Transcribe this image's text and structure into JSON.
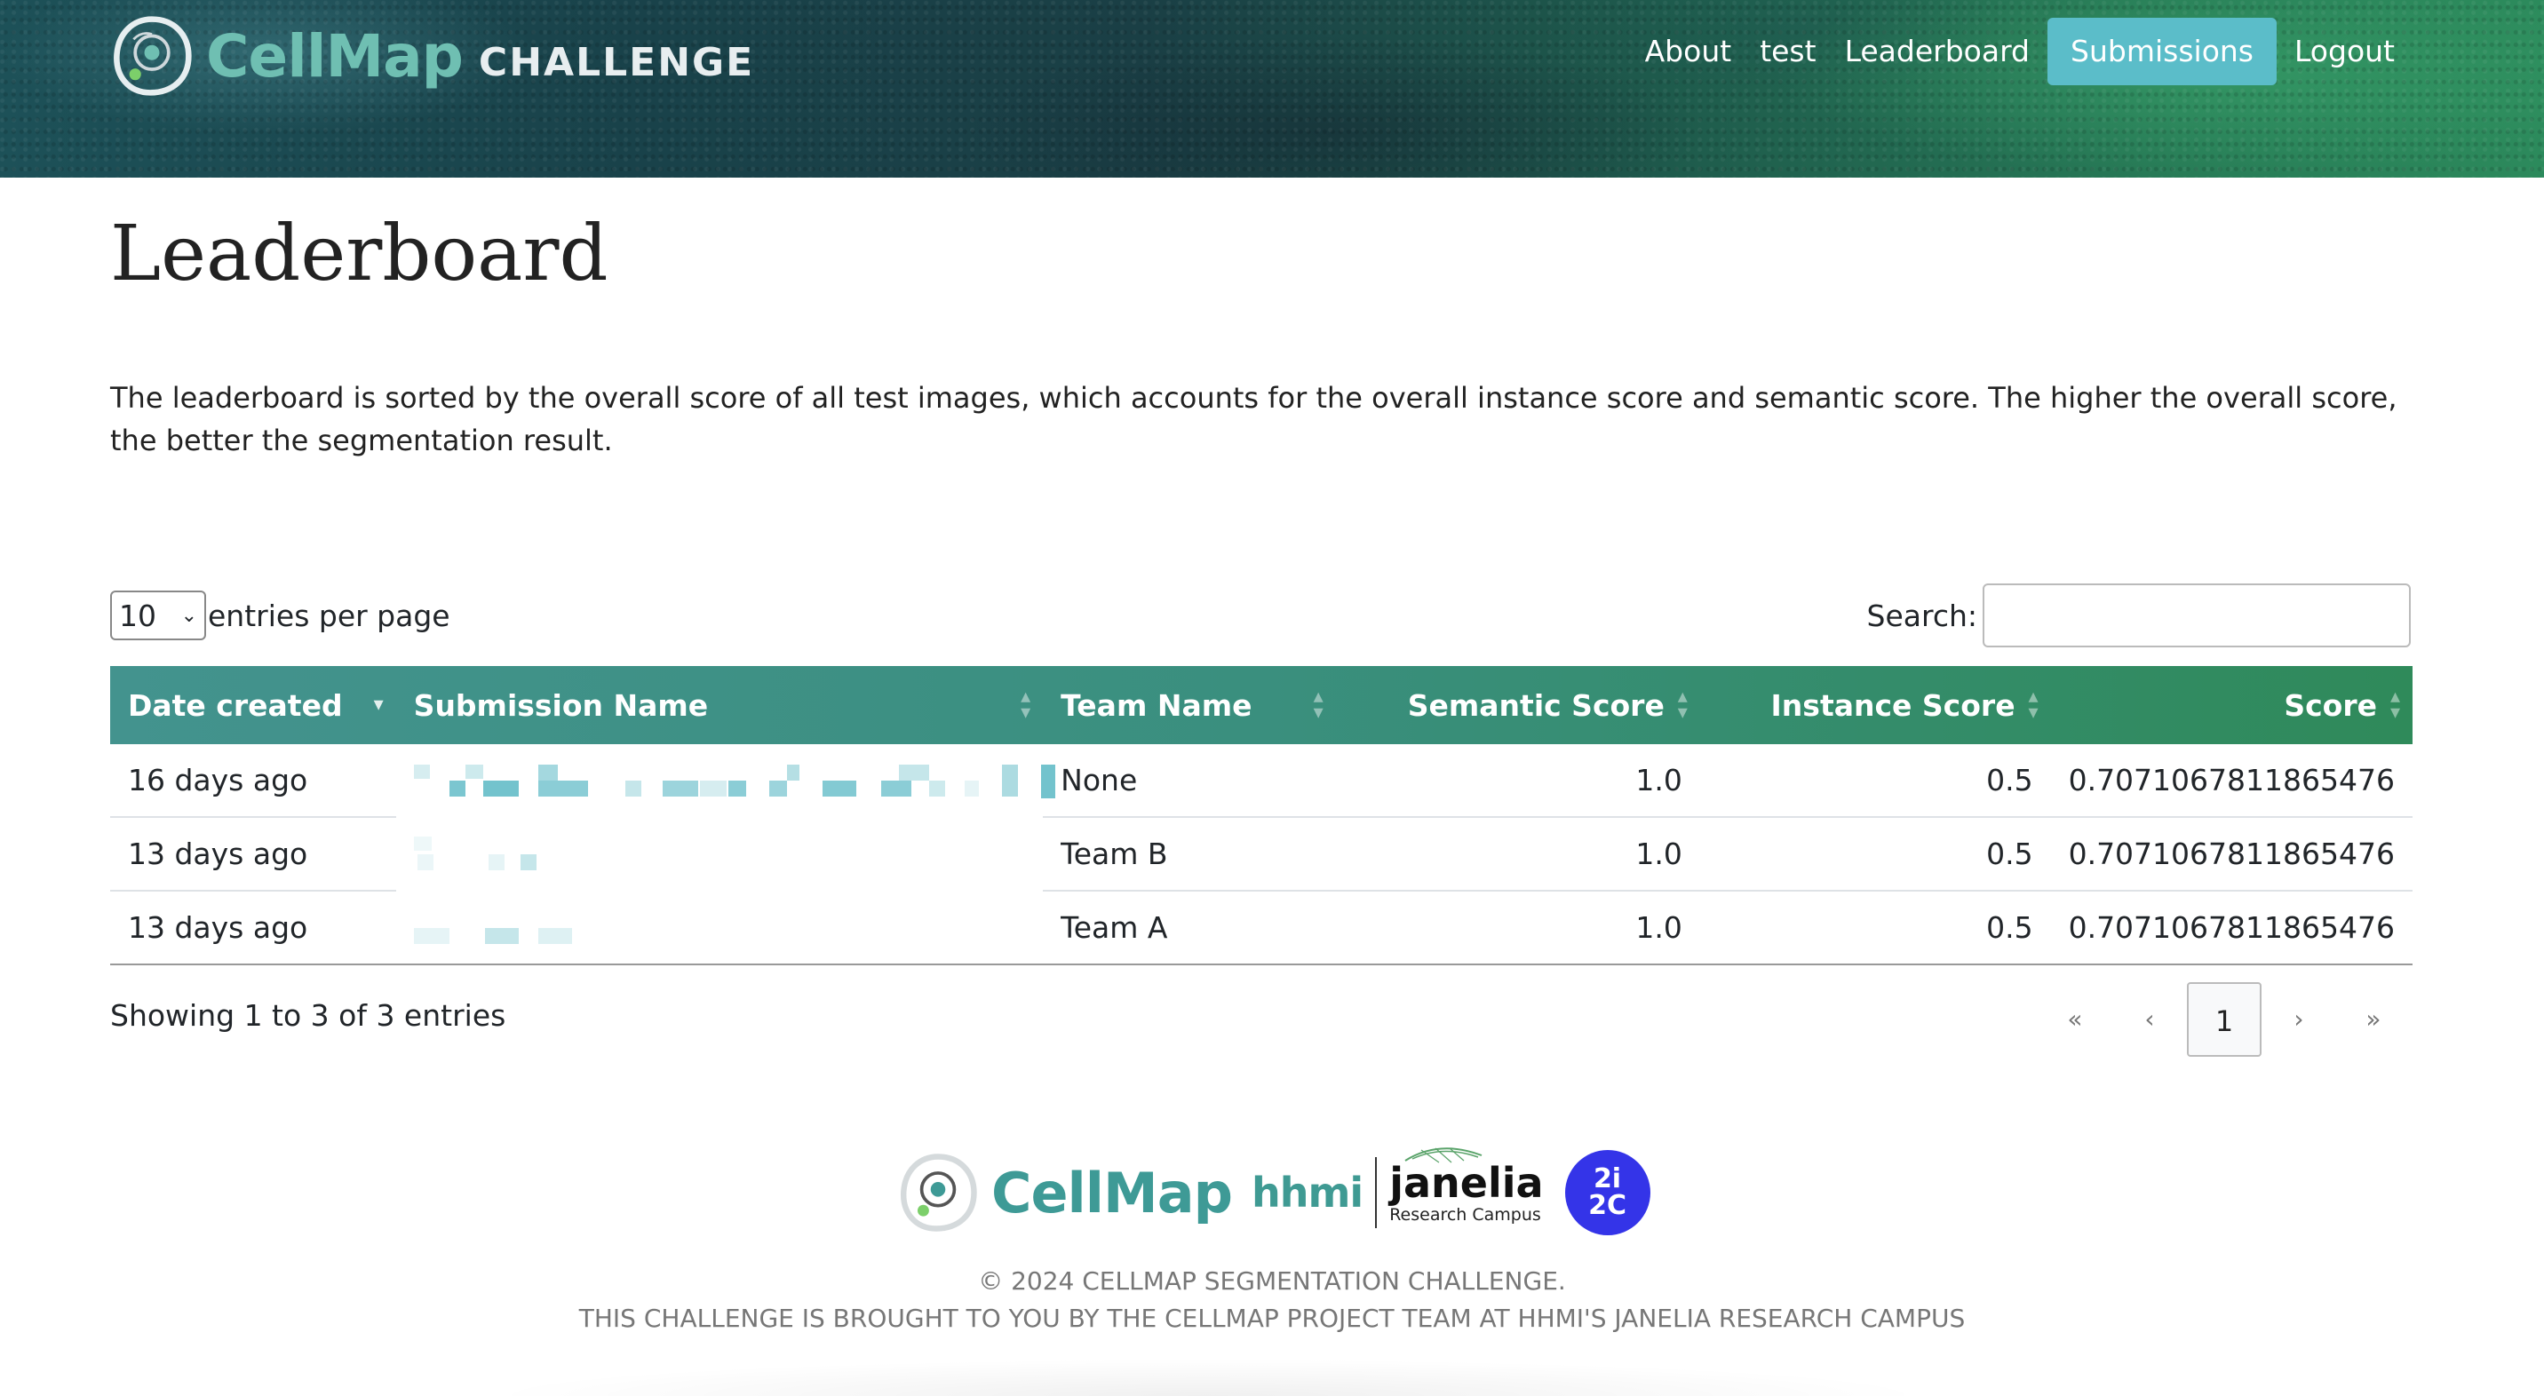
{
  "brand": {
    "name": "CellMap",
    "suffix": "CHALLENGE"
  },
  "nav": {
    "items": [
      {
        "label": "About"
      },
      {
        "label": "test"
      },
      {
        "label": "Leaderboard"
      },
      {
        "label": "Submissions",
        "active": true
      },
      {
        "label": "Logout"
      }
    ]
  },
  "page": {
    "title": "Leaderboard",
    "description": "The leaderboard is sorted by the overall score of all test images, which accounts for the overall instance score and semantic score. The higher the overall score, the better the segmentation result."
  },
  "controls": {
    "page_length": "10",
    "page_length_label": "entries per page",
    "search_label": "Search:",
    "search_value": ""
  },
  "table": {
    "columns": [
      "Date created",
      "Submission Name",
      "Team Name",
      "Semantic Score",
      "Instance Score",
      "Score"
    ],
    "rows": [
      {
        "date": "16 days ago",
        "submission": "",
        "team": "None",
        "semantic": "1.0",
        "instance": "0.5",
        "score": "0.7071067811865476"
      },
      {
        "date": "13 days ago",
        "submission": "",
        "team": "Team B",
        "semantic": "1.0",
        "instance": "0.5",
        "score": "0.7071067811865476"
      },
      {
        "date": "13 days ago",
        "submission": "",
        "team": "Team A",
        "semantic": "1.0",
        "instance": "0.5",
        "score": "0.7071067811865476"
      }
    ]
  },
  "pagination": {
    "info": "Showing 1 to 3 of 3 entries",
    "first": "«",
    "prev": "‹",
    "current": "1",
    "next": "›",
    "last": "»"
  },
  "footer": {
    "logo_cellmap": "CellMap",
    "logo_hhmi": "hhmi",
    "logo_janelia": "janelia",
    "logo_janelia_sub": "Research Campus",
    "logo_2i2c_top": "2i",
    "logo_2i2c_bottom": "2C",
    "copyright": "© 2024 CELLMAP SEGMENTATION CHALLENGE.",
    "credit": "THIS CHALLENGE IS BROUGHT TO YOU BY THE CELLMAP PROJECT TEAM AT HHMI'S JANELIA RESEARCH CAMPUS"
  },
  "colors": {
    "accent": "#5bbdc9",
    "table_header_start": "#43938e",
    "table_header_end": "#2f8a5a",
    "brand_teal": "#3e9a96",
    "badge_2i2c": "#3434e8"
  },
  "icons": {
    "sort": "sort-arrows-icon",
    "select": "chevron-down-icon"
  }
}
